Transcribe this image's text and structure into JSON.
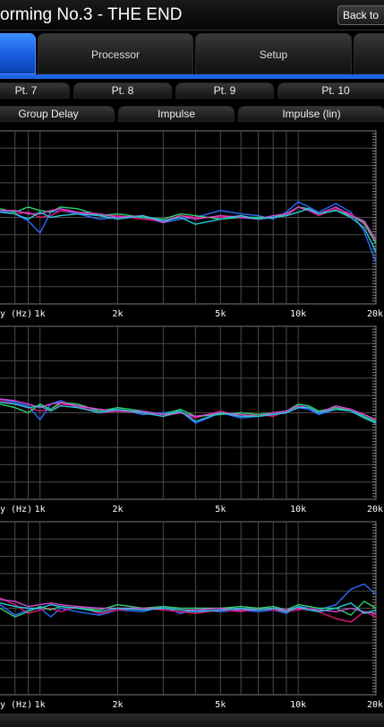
{
  "header": {
    "title": "orming No.3 - THE END",
    "back_label": "Back to"
  },
  "tabs": [
    {
      "label": "",
      "active": true
    },
    {
      "label": "Processor",
      "active": false
    },
    {
      "label": "Setup",
      "active": false
    },
    {
      "label": "",
      "active": false
    }
  ],
  "point_tabs": [
    "Pt. 7",
    "Pt. 8",
    "Pt. 9",
    "Pt. 10"
  ],
  "view_tabs": [
    "Group Delay",
    "Impulse",
    "Impulse (lin)"
  ],
  "colors": {
    "accent": "#1f63e6",
    "grid": "#4a4a4a",
    "axis_text": "#ffffff"
  },
  "chart_data": [
    {
      "type": "line",
      "xlabel": "y (Hz)",
      "x_scale": "log",
      "xlim": [
        700,
        20000
      ],
      "x_ticks": [
        {
          "value": 1000,
          "label": "1k"
        },
        {
          "value": 2000,
          "label": "2k"
        },
        {
          "value": 5000,
          "label": "5k"
        },
        {
          "value": 10000,
          "label": "10k"
        },
        {
          "value": 20000,
          "label": "20k"
        }
      ],
      "ylim": [
        0,
        100
      ],
      "grid": true,
      "series": [
        {
          "color": "#2d6cff",
          "x": [
            700,
            800,
            900,
            1000,
            1100,
            1200,
            1400,
            1700,
            2000,
            2500,
            3000,
            3500,
            4000,
            5000,
            6000,
            7000,
            8000,
            9000,
            10000,
            11000,
            12000,
            14000,
            16000,
            18000,
            20000
          ],
          "y": [
            54,
            52,
            48,
            41,
            53,
            54,
            52,
            49,
            50,
            50,
            47,
            49,
            50,
            54,
            52,
            51,
            49,
            53,
            59,
            56,
            53,
            58,
            53,
            42,
            24
          ]
        },
        {
          "color": "#e0147a",
          "x": [
            700,
            800,
            900,
            1000,
            1100,
            1200,
            1400,
            1700,
            2000,
            2500,
            3000,
            3500,
            4000,
            5000,
            6000,
            7000,
            8000,
            9000,
            10000,
            11000,
            12000,
            14000,
            16000,
            18000,
            20000
          ],
          "y": [
            53,
            52,
            53,
            50,
            51,
            54,
            53,
            51,
            51,
            49,
            48,
            51,
            50,
            50,
            51,
            49,
            50,
            51,
            56,
            54,
            51,
            55,
            52,
            46,
            35
          ]
        },
        {
          "color": "#2fd070",
          "x": [
            700,
            800,
            900,
            1000,
            1100,
            1200,
            1400,
            1700,
            2000,
            2500,
            3000,
            3500,
            4000,
            5000,
            6000,
            7000,
            8000,
            9000,
            10000,
            11000,
            12000,
            14000,
            16000,
            18000,
            20000
          ],
          "y": [
            55,
            53,
            56,
            54,
            53,
            56,
            55,
            51,
            52,
            50,
            49,
            52,
            51,
            49,
            50,
            50,
            50,
            52,
            56,
            55,
            52,
            54,
            51,
            47,
            35
          ]
        },
        {
          "color": "#d14cd8",
          "x": [
            700,
            800,
            900,
            1000,
            1100,
            1200,
            1400,
            1700,
            2000,
            2500,
            3000,
            3500,
            4000,
            5000,
            6000,
            7000,
            8000,
            9000,
            10000,
            11000,
            12000,
            14000,
            16000,
            18000,
            20000
          ],
          "y": [
            54,
            54,
            52,
            52,
            54,
            55,
            53,
            52,
            50,
            51,
            47,
            51,
            49,
            51,
            50,
            49,
            51,
            52,
            56,
            54,
            52,
            56,
            51,
            48,
            37
          ]
        },
        {
          "color": "#28c8d8",
          "x": [
            700,
            800,
            900,
            1000,
            1100,
            1200,
            1400,
            1700,
            2000,
            2500,
            3000,
            3500,
            4000,
            5000,
            6000,
            7000,
            8000,
            9000,
            10000,
            11000,
            12000,
            14000,
            16000,
            18000,
            20000
          ],
          "y": [
            53,
            52,
            49,
            53,
            50,
            51,
            52,
            51,
            49,
            51,
            48,
            50,
            46,
            49,
            51,
            49,
            50,
            51,
            53,
            55,
            52,
            54,
            50,
            44,
            30
          ]
        }
      ]
    },
    {
      "type": "line",
      "xlabel": "y (Hz)",
      "x_scale": "log",
      "xlim": [
        700,
        20000
      ],
      "x_ticks": [
        {
          "value": 1000,
          "label": "1k"
        },
        {
          "value": 2000,
          "label": "2k"
        },
        {
          "value": 5000,
          "label": "5k"
        },
        {
          "value": 10000,
          "label": "10k"
        },
        {
          "value": 20000,
          "label": "20k"
        }
      ],
      "ylim": [
        0,
        100
      ],
      "grid": true,
      "series": [
        {
          "color": "#2d6cff",
          "x": [
            700,
            800,
            900,
            1000,
            1100,
            1200,
            1400,
            1700,
            2000,
            2500,
            3000,
            3500,
            4000,
            5000,
            6000,
            7000,
            8000,
            9000,
            10000,
            11000,
            12000,
            14000,
            16000,
            18000,
            20000
          ],
          "y": [
            58,
            56,
            54,
            46,
            55,
            57,
            53,
            51,
            52,
            49,
            50,
            51,
            44,
            50,
            47,
            48,
            49,
            50,
            53,
            52,
            49,
            52,
            52,
            48,
            44
          ]
        },
        {
          "color": "#e0147a",
          "x": [
            700,
            800,
            900,
            1000,
            1100,
            1200,
            1400,
            1700,
            2000,
            2500,
            3000,
            3500,
            4000,
            5000,
            6000,
            7000,
            8000,
            9000,
            10000,
            11000,
            12000,
            14000,
            16000,
            18000,
            20000
          ],
          "y": [
            57,
            55,
            53,
            51,
            52,
            55,
            54,
            50,
            51,
            50,
            48,
            50,
            47,
            51,
            48,
            49,
            48,
            51,
            54,
            53,
            50,
            53,
            52,
            49,
            46
          ]
        },
        {
          "color": "#2fd070",
          "x": [
            700,
            800,
            900,
            1000,
            1100,
            1200,
            1400,
            1700,
            2000,
            2500,
            3000,
            3500,
            4000,
            5000,
            6000,
            7000,
            8000,
            9000,
            10000,
            11000,
            12000,
            14000,
            16000,
            18000,
            20000
          ],
          "y": [
            55,
            53,
            50,
            55,
            52,
            56,
            55,
            51,
            53,
            51,
            49,
            52,
            48,
            49,
            50,
            49,
            50,
            51,
            55,
            54,
            51,
            53,
            51,
            48,
            45
          ]
        },
        {
          "color": "#d14cd8",
          "x": [
            700,
            800,
            900,
            1000,
            1100,
            1200,
            1400,
            1700,
            2000,
            2500,
            3000,
            3500,
            4000,
            5000,
            6000,
            7000,
            8000,
            9000,
            10000,
            11000,
            12000,
            14000,
            16000,
            18000,
            20000
          ],
          "y": [
            58,
            57,
            55,
            53,
            55,
            56,
            54,
            52,
            51,
            51,
            49,
            50,
            48,
            50,
            49,
            48,
            50,
            51,
            54,
            53,
            50,
            54,
            52,
            49,
            46
          ]
        },
        {
          "color": "#28c8d8",
          "x": [
            700,
            800,
            900,
            1000,
            1100,
            1200,
            1400,
            1700,
            2000,
            2500,
            3000,
            3500,
            4000,
            5000,
            6000,
            7000,
            8000,
            9000,
            10000,
            11000,
            12000,
            14000,
            16000,
            18000,
            20000
          ],
          "y": [
            56,
            55,
            53,
            54,
            51,
            54,
            53,
            50,
            52,
            50,
            48,
            51,
            45,
            50,
            48,
            48,
            49,
            50,
            53,
            53,
            50,
            52,
            51,
            47,
            44
          ]
        }
      ]
    },
    {
      "type": "line",
      "xlabel": "y (Hz)",
      "x_scale": "log",
      "xlim": [
        700,
        20000
      ],
      "x_ticks": [
        {
          "value": 1000,
          "label": "1k"
        },
        {
          "value": 2000,
          "label": "2k"
        },
        {
          "value": 5000,
          "label": "5k"
        },
        {
          "value": 10000,
          "label": "10k"
        },
        {
          "value": 20000,
          "label": "20k"
        }
      ],
      "ylim": [
        0,
        100
      ],
      "grid": true,
      "series": [
        {
          "color": "#2d6cff",
          "x": [
            700,
            800,
            900,
            1000,
            1100,
            1200,
            1400,
            1700,
            2000,
            2500,
            3000,
            3500,
            4000,
            5000,
            6000,
            7000,
            8000,
            9000,
            10000,
            11000,
            12000,
            14000,
            16000,
            18000,
            20000
          ],
          "y": [
            52,
            46,
            49,
            50,
            45,
            50,
            48,
            46,
            49,
            48,
            51,
            47,
            49,
            48,
            49,
            48,
            49,
            47,
            51,
            50,
            49,
            52,
            61,
            64,
            58
          ]
        },
        {
          "color": "#e0147a",
          "x": [
            700,
            800,
            900,
            1000,
            1100,
            1200,
            1400,
            1700,
            2000,
            2500,
            3000,
            3500,
            4000,
            5000,
            6000,
            7000,
            8000,
            9000,
            10000,
            11000,
            12000,
            14000,
            16000,
            18000,
            20000
          ],
          "y": [
            56,
            52,
            47,
            49,
            50,
            48,
            51,
            47,
            49,
            50,
            49,
            48,
            47,
            49,
            48,
            50,
            49,
            48,
            49,
            50,
            48,
            44,
            42,
            48,
            45
          ]
        },
        {
          "color": "#2fd070",
          "x": [
            700,
            800,
            900,
            1000,
            1100,
            1200,
            1400,
            1700,
            2000,
            2500,
            3000,
            3500,
            4000,
            5000,
            6000,
            7000,
            8000,
            9000,
            10000,
            11000,
            12000,
            14000,
            16000,
            18000,
            20000
          ],
          "y": [
            50,
            45,
            48,
            51,
            49,
            51,
            50,
            49,
            52,
            50,
            51,
            50,
            50,
            50,
            51,
            50,
            51,
            49,
            52,
            51,
            50,
            50,
            46,
            54,
            50
          ]
        },
        {
          "color": "#d14cd8",
          "x": [
            700,
            800,
            900,
            1000,
            1100,
            1200,
            1400,
            1700,
            2000,
            2500,
            3000,
            3500,
            4000,
            5000,
            6000,
            7000,
            8000,
            9000,
            10000,
            11000,
            12000,
            14000,
            16000,
            18000,
            20000
          ],
          "y": [
            55,
            54,
            51,
            52,
            53,
            52,
            51,
            50,
            50,
            50,
            50,
            49,
            49,
            50,
            49,
            49,
            50,
            49,
            50,
            49,
            49,
            48,
            50,
            48,
            47
          ]
        },
        {
          "color": "#28c8d8",
          "x": [
            700,
            800,
            900,
            1000,
            1100,
            1200,
            1400,
            1700,
            2000,
            2500,
            3000,
            3500,
            4000,
            5000,
            6000,
            7000,
            8000,
            9000,
            10000,
            11000,
            12000,
            14000,
            16000,
            18000,
            20000
          ],
          "y": [
            53,
            51,
            50,
            50,
            52,
            51,
            50,
            48,
            50,
            49,
            50,
            49,
            48,
            49,
            50,
            49,
            50,
            48,
            51,
            49,
            48,
            50,
            53,
            47,
            49
          ]
        }
      ]
    }
  ]
}
